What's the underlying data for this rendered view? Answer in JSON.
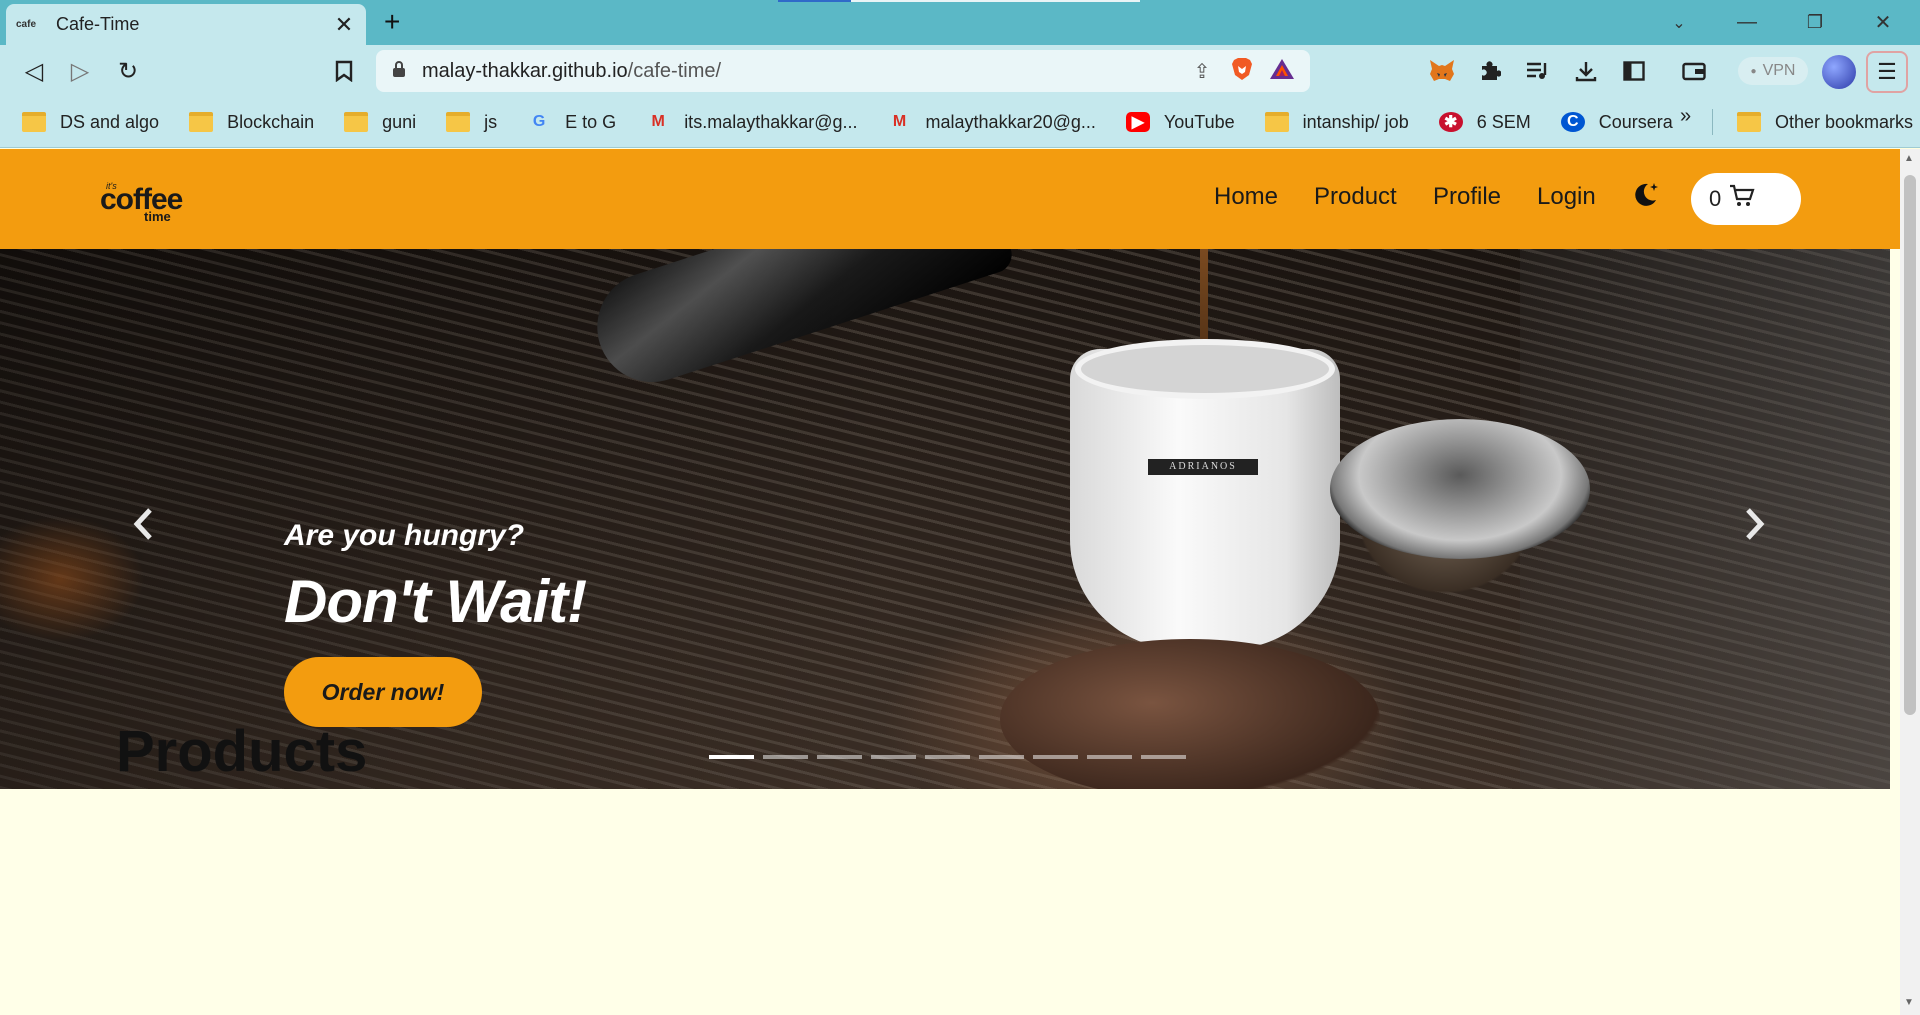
{
  "browser": {
    "tab": {
      "favicon_text": "cafe",
      "title": "Cafe-Time"
    },
    "url": {
      "host": "malay-thakkar.github.io",
      "path": "/cafe-time/"
    },
    "vpn_label": "VPN",
    "bookmarks": [
      {
        "icon": "folder",
        "label": "DS and algo"
      },
      {
        "icon": "folder",
        "label": "Blockchain"
      },
      {
        "icon": "folder",
        "label": "guni"
      },
      {
        "icon": "folder",
        "label": "js"
      },
      {
        "icon": "google",
        "label": "E to G"
      },
      {
        "icon": "gmail",
        "label": "its.malaythakkar@g..."
      },
      {
        "icon": "gmail",
        "label": "malaythakkar20@g..."
      },
      {
        "icon": "youtube",
        "label": "YouTube"
      },
      {
        "icon": "folder",
        "label": "intanship/ job"
      },
      {
        "icon": "sem",
        "label": "6 SEM"
      },
      {
        "icon": "coursera",
        "label": "Coursera"
      }
    ],
    "more_label": "»",
    "other_bookmarks": "Other bookmarks"
  },
  "site": {
    "logo": {
      "small": "it's",
      "main": "coffee",
      "sub": "time"
    },
    "nav": {
      "home": "Home",
      "product": "Product",
      "profile": "Profile",
      "login": "Login"
    },
    "cart_count": "0",
    "hero": {
      "subtitle": "Are you hungry?",
      "headline": "Don't Wait!",
      "cta": "Order now!",
      "cup_band": "ADRIANOS",
      "slide_count": 9,
      "active_slide": 1
    },
    "section_title": "Products"
  },
  "colors": {
    "tab_strip": "#5bb8c6",
    "toolbar": "#c5e8ed",
    "site_nav": "#f39c0f",
    "page_bg": "#ffffe8"
  }
}
